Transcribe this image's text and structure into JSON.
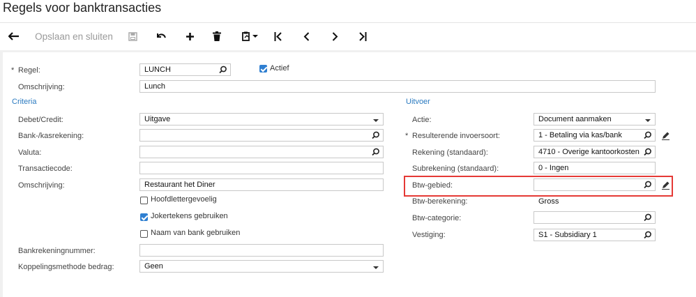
{
  "window": {
    "title": "Regels voor banktransacties"
  },
  "toolbar": {
    "save_close_label": "Opslaan en sluiten",
    "icons": [
      "back-arrow-icon",
      "save-icon",
      "undo-icon",
      "plus-icon",
      "trash-icon",
      "copy-paste-icon",
      "first-page-icon",
      "previous-icon",
      "next-icon",
      "last-page-icon"
    ]
  },
  "form": {
    "rule_label": "Regel:",
    "rule_value": "LUNCH",
    "active_label": "Actief",
    "active_checked": true,
    "description_label": "Omschrijving:",
    "description_value": "Lunch"
  },
  "criteria": {
    "title": "Criteria",
    "debit_credit_label": "Debet/Credit:",
    "debit_credit_value": "Uitgave",
    "bank_account_label": "Bank-/kasrekening:",
    "bank_account_value": "",
    "currency_label": "Valuta:",
    "currency_value": "",
    "transaction_code_label": "Transactiecode:",
    "transaction_code_value": "",
    "description_label": "Omschrijving:",
    "description_value": "Restaurant het Diner",
    "case_sensitive_label": "Hoofdlettergevoelig",
    "case_sensitive_checked": false,
    "wildcards_label": "Jokertekens gebruiken",
    "wildcards_checked": true,
    "bank_name_label": "Naam van bank gebruiken",
    "bank_name_checked": false,
    "bank_account_number_label": "Bankrekeningnummer:",
    "bank_account_number_value": "",
    "amount_matching_label": "Koppelingsmethode bedrag:",
    "amount_matching_value": "Geen"
  },
  "output": {
    "title": "Uitvoer",
    "action_label": "Actie:",
    "action_value": "Document aanmaken",
    "doc_type_label": "Resulterende invoersoort:",
    "doc_type_value": "1 - Betaling via kas/bank",
    "account_label": "Rekening (standaard):",
    "account_value": "4710 - Overige kantoorkosten",
    "subaccount_label": "Subrekening (standaard):",
    "subaccount_value": "0 - Ingen",
    "tax_zone_label": "Btw-gebied:",
    "tax_zone_value": "",
    "tax_calc_label": "Btw-berekening:",
    "tax_calc_value": "Gross",
    "tax_category_label": "Btw-categorie:",
    "tax_category_value": "",
    "branch_label": "Vestiging:",
    "branch_value": "S1 - Subsidiary 1"
  },
  "colors": {
    "accent": "#2a7ac0",
    "check": "#2f7fd1",
    "highlight": "#e53935"
  }
}
